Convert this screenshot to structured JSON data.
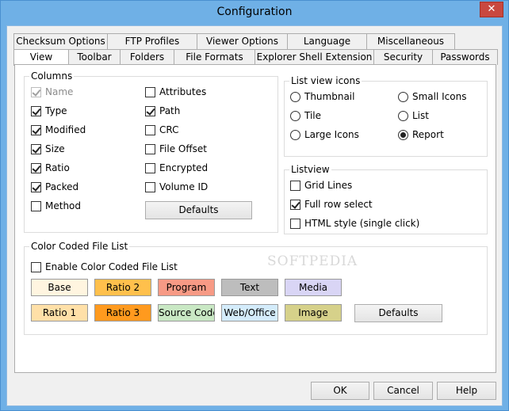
{
  "window": {
    "title": "Configuration",
    "close_symbol": "✕"
  },
  "tabs_row1": [
    "Checksum Options",
    "FTP Profiles",
    "Viewer Options",
    "Language",
    "Miscellaneous"
  ],
  "tabs_row2": [
    "View",
    "Toolbar",
    "Folders",
    "File Formats",
    "Explorer Shell Extension",
    "Security",
    "Passwords"
  ],
  "columns": {
    "label": "Columns",
    "left": [
      {
        "label": "Name",
        "checked": true,
        "disabled": true
      },
      {
        "label": "Type",
        "checked": true
      },
      {
        "label": "Modified",
        "checked": true
      },
      {
        "label": "Size",
        "checked": true
      },
      {
        "label": "Ratio",
        "checked": true
      },
      {
        "label": "Packed",
        "checked": true
      },
      {
        "label": "Method",
        "checked": false
      }
    ],
    "right": [
      {
        "label": "Attributes",
        "checked": false
      },
      {
        "label": "Path",
        "checked": true
      },
      {
        "label": "CRC",
        "checked": false
      },
      {
        "label": "File Offset",
        "checked": false
      },
      {
        "label": "Encrypted",
        "checked": false
      },
      {
        "label": "Volume ID",
        "checked": false
      }
    ],
    "defaults_label": "Defaults"
  },
  "list_view_icons": {
    "label": "List view icons",
    "options": [
      {
        "label": "Thumbnail",
        "selected": false
      },
      {
        "label": "Small Icons",
        "selected": false
      },
      {
        "label": "Tile",
        "selected": false
      },
      {
        "label": "List",
        "selected": false
      },
      {
        "label": "Large Icons",
        "selected": false
      },
      {
        "label": "Report",
        "selected": true
      }
    ]
  },
  "listview": {
    "label": "Listview",
    "options": [
      {
        "label": "Grid Lines",
        "checked": false
      },
      {
        "label": "Full row select",
        "checked": true
      },
      {
        "label": "HTML style (single click)",
        "checked": false
      }
    ]
  },
  "watermark": "SOFTPEDIA",
  "color_coded": {
    "label": "Color Coded File List",
    "enable_label": "Enable Color Coded File List",
    "enable_checked": false,
    "swatches_row1": [
      {
        "label": "Base",
        "color": "#fff5e0"
      },
      {
        "label": "Ratio 2",
        "color": "#ffc04c"
      },
      {
        "label": "Program",
        "color": "#f79a85"
      },
      {
        "label": "Text",
        "color": "#bdbdbd"
      },
      {
        "label": "Media",
        "color": "#d9d5f5"
      }
    ],
    "swatches_row2": [
      {
        "label": "Ratio 1",
        "color": "#ffe0a8"
      },
      {
        "label": "Ratio 3",
        "color": "#ff9a1e"
      },
      {
        "label": "Source Code",
        "color": "#c9e8c4"
      },
      {
        "label": "Web/Office",
        "color": "#d4ecfb"
      },
      {
        "label": "Image",
        "color": "#d6d18a"
      }
    ],
    "defaults_label": "Defaults"
  },
  "buttons": {
    "ok": "OK",
    "cancel": "Cancel",
    "help": "Help"
  }
}
